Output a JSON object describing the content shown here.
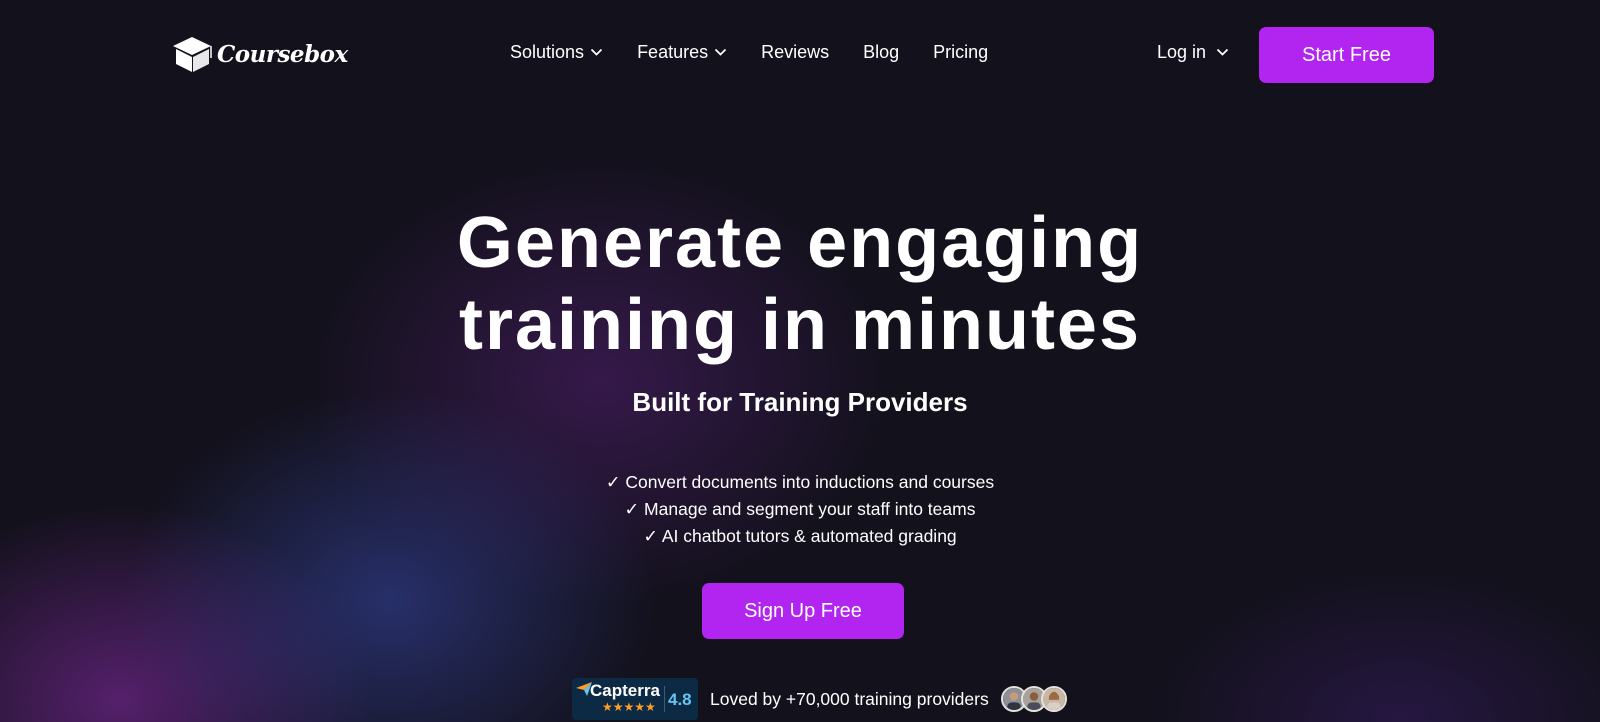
{
  "brand": {
    "name": "Coursebox"
  },
  "nav": {
    "items": [
      {
        "label": "Solutions",
        "dropdown": true
      },
      {
        "label": "Features",
        "dropdown": true
      },
      {
        "label": "Reviews",
        "dropdown": false
      },
      {
        "label": "Blog",
        "dropdown": false
      },
      {
        "label": "Pricing",
        "dropdown": false
      }
    ],
    "login_label": "Log in",
    "cta_label": "Start Free"
  },
  "hero": {
    "title_line1": "Generate engaging",
    "title_line2": "training in minutes",
    "subtitle": "Built for Training Providers",
    "features": [
      "✓ Convert documents into inductions and courses",
      "✓ Manage and segment your staff into teams",
      "✓ AI chatbot tutors & automated grading"
    ],
    "cta_label": "Sign Up Free"
  },
  "proof": {
    "capterra_name": "Capterra",
    "capterra_stars": "★★★★★",
    "capterra_score": "4.8",
    "text": "Loved by +70,000 training providers"
  },
  "colors": {
    "accent": "#b224ef",
    "background": "#13111c",
    "capterra_bg": "#0d2a45",
    "star": "#ff9d28"
  },
  "icons": [
    "graduation-cap-icon",
    "chevron-down-icon",
    "capterra-logo-icon",
    "star-icon"
  ]
}
